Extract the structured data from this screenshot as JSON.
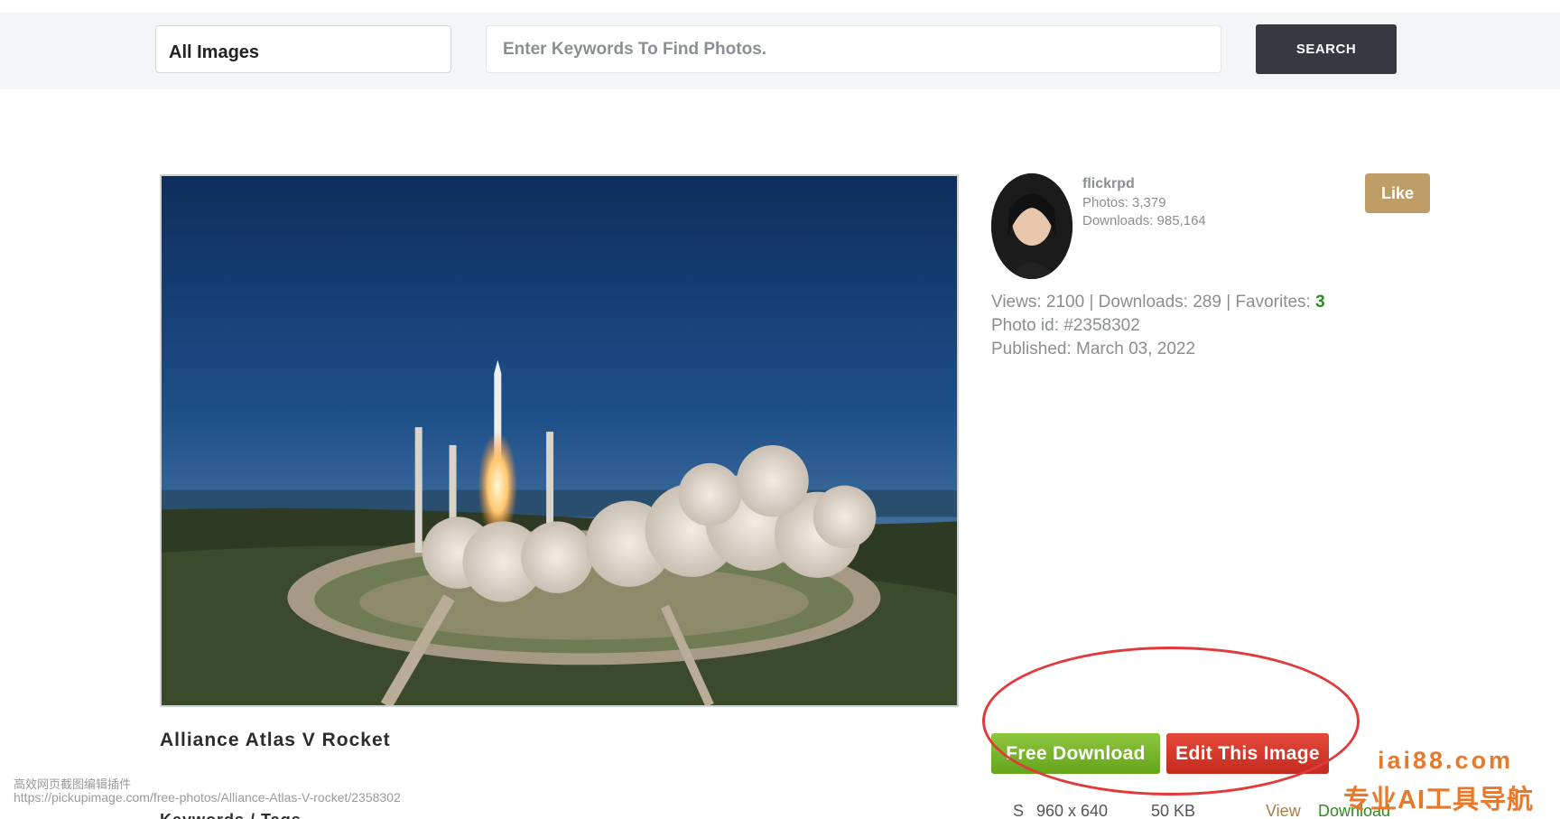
{
  "header": {
    "category": "All Images",
    "search_placeholder": "Enter Keywords To Find Photos.",
    "search_label": "SEARCH"
  },
  "photo": {
    "title": "Alliance Atlas V Rocket",
    "keywords_heading": "Keywords / Tags"
  },
  "author": {
    "name": "flickrpd",
    "photos": "Photos: 3,379",
    "downloads": "Downloads: 985,164",
    "like_label": "Like"
  },
  "stats": {
    "views_downloads": "Views: 2100 | Downloads: 289 | Favorites: ",
    "favorites": "3",
    "photo_id": "Photo id: #2358302",
    "published": "Published: March 03, 2022"
  },
  "actions": {
    "free_download": "Free Download",
    "edit_image": "Edit This Image"
  },
  "size_row": {
    "code": "S",
    "dimensions": "960 x 640",
    "filesize": "50 KB",
    "view": "View",
    "download": "Download"
  },
  "overlay": {
    "watermark_cn": "高效网页截图编辑插件",
    "watermark_url": "https://pickupimage.com/free-photos/Alliance-Atlas-V-rocket/2358302",
    "brand_domain": "iai88.com",
    "brand_cn": "专业AI工具导航"
  },
  "colors": {
    "accent_green": "#2e8b1e",
    "like_gold": "#bf9d67",
    "edit_red": "#d8382a",
    "highlight_red": "#e23a3a",
    "brand_orange": "#e8792b"
  }
}
